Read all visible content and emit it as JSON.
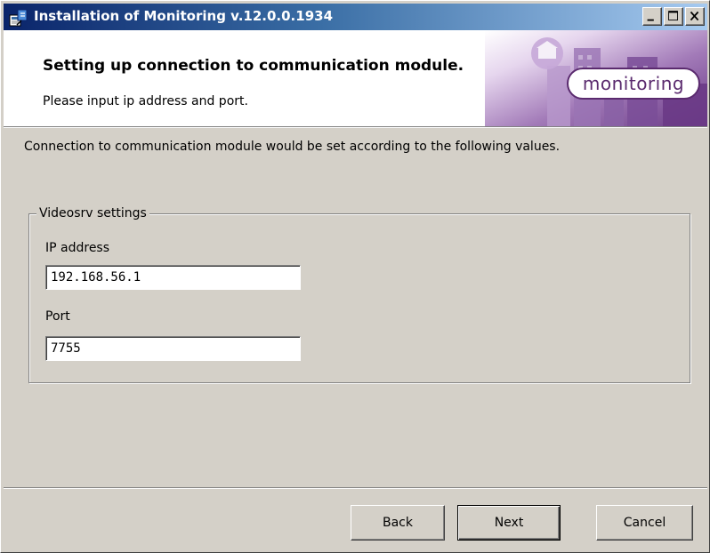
{
  "window": {
    "title": "Installation of Monitoring v.12.0.0.1934",
    "app_icon": "installer-icon",
    "caption_buttons": [
      "minimize-icon",
      "maximize-icon",
      "close-icon"
    ]
  },
  "banner": {
    "title": "Setting up connection to communication module.",
    "subtitle": "Please input ip address and port.",
    "logo_text": "monitoring",
    "logo_color": "#5a2a6e",
    "art_color": "#8a5aa8"
  },
  "content": {
    "info": "Connection to communication module would be set according to the following values.",
    "group": {
      "label": "Videosrv settings",
      "fields": [
        {
          "label": "IP address",
          "value": "192.168.56.1"
        },
        {
          "label": "Port",
          "value": "7755"
        }
      ]
    }
  },
  "buttons": {
    "back": "Back",
    "next": "Next",
    "cancel": "Cancel"
  },
  "colors": {
    "titlebar_start": "#0a246a",
    "titlebar_end": "#a6caf0",
    "dialog_bg": "#d4d0c8"
  }
}
